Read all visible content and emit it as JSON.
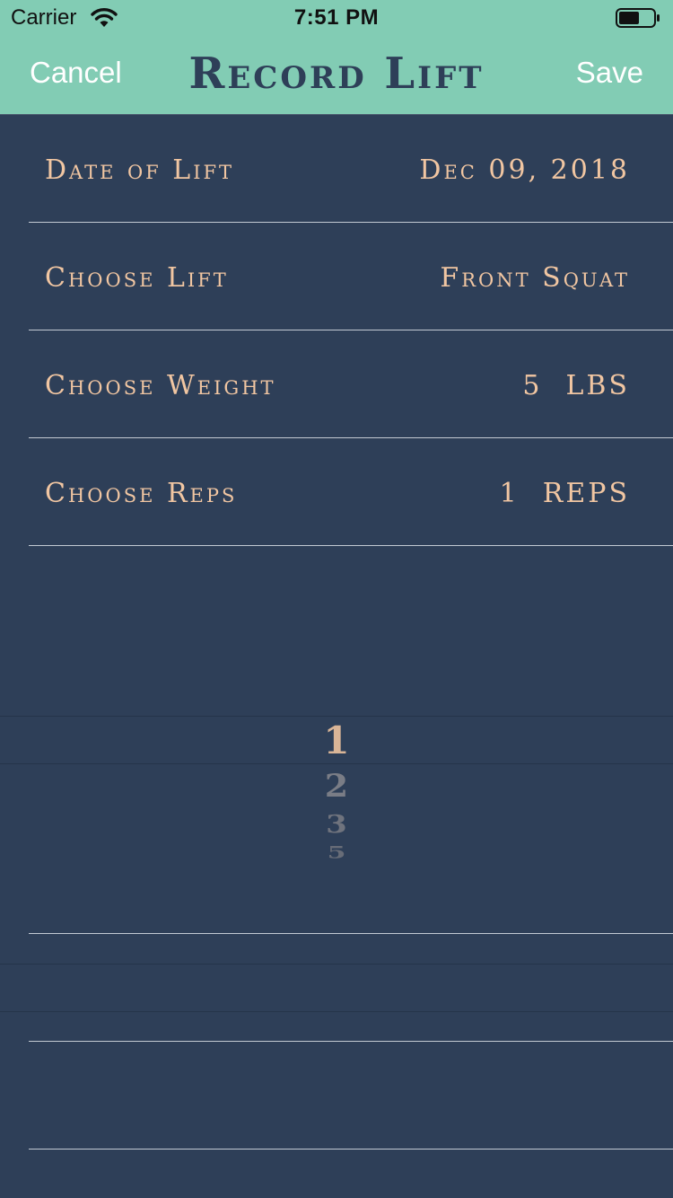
{
  "status_bar": {
    "carrier": "Carrier",
    "time": "7:51 PM"
  },
  "nav": {
    "cancel_label": "Cancel",
    "title": "Record Lift",
    "save_label": "Save"
  },
  "form": {
    "date": {
      "label": "Date of Lift",
      "value": "Dec 09, 2018"
    },
    "lift": {
      "label": "Choose Lift",
      "value": "Front Squat"
    },
    "weight": {
      "label": "Choose Weight",
      "value": "5",
      "unit": "LBS"
    },
    "reps": {
      "label": "Choose Reps",
      "value": "1",
      "unit": "REPS"
    }
  },
  "reps_picker": {
    "selected": "1",
    "below": [
      "2",
      "3",
      "5"
    ]
  },
  "colors": {
    "nav_background": "#82ccb4",
    "page_background": "#2e3f58",
    "accent_text": "#f1c6a2",
    "title_text": "#2e3f58"
  }
}
